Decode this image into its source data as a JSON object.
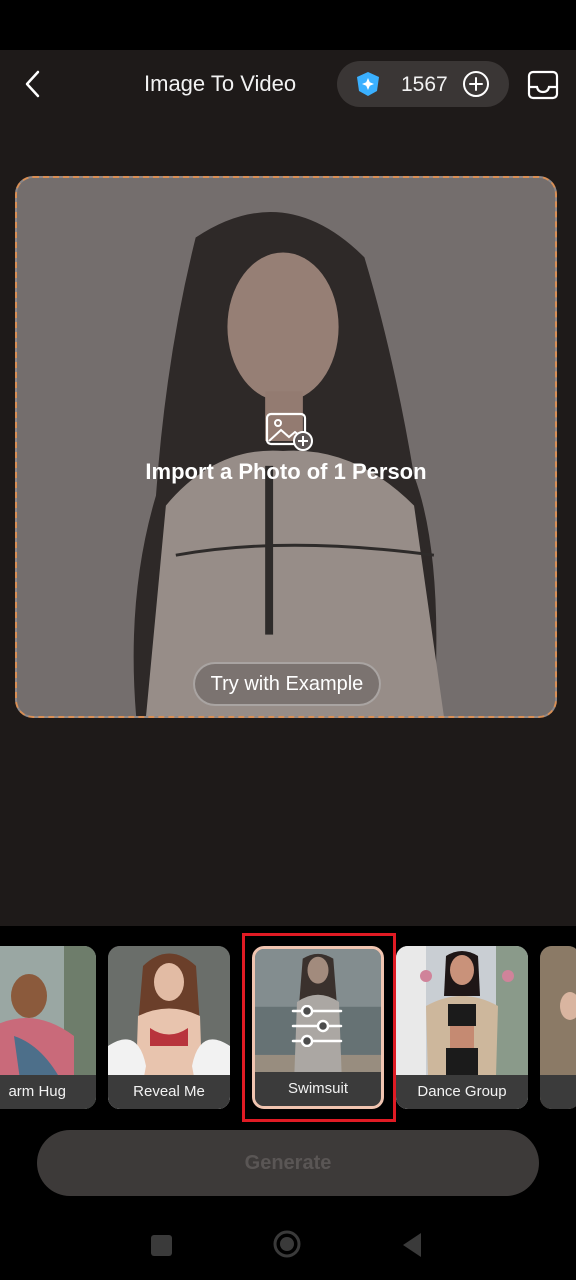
{
  "header": {
    "title": "Image To Video",
    "credits": "1567"
  },
  "upload": {
    "prompt": "Import a Photo of 1 Person",
    "example_button": "Try with Example"
  },
  "templates": [
    {
      "label": "arm Hug"
    },
    {
      "label": "Reveal Me"
    },
    {
      "label": "Swimsuit"
    },
    {
      "label": "Dance Group"
    }
  ],
  "generate_label": "Generate",
  "colors": {
    "accent_border": "#d98f55",
    "selected_card": "#f0c4b0",
    "highlight": "#e01b24",
    "gem": "#3ab0ff"
  }
}
